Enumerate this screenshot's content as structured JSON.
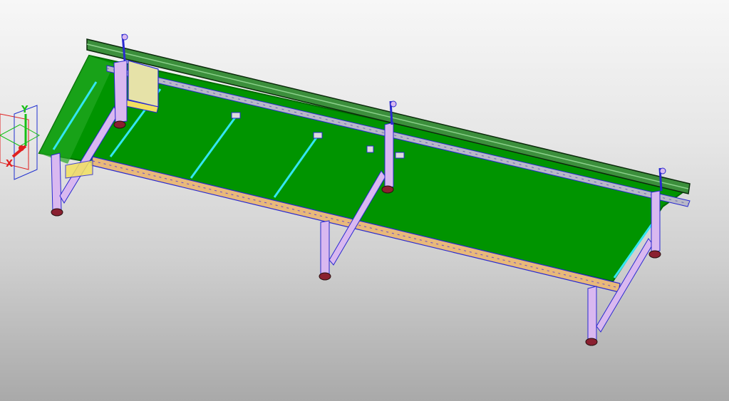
{
  "viewport": {
    "background_top": "#f7f7f7",
    "background_bottom": "#a9a9a9"
  },
  "model": {
    "belt_color": "#009400",
    "belt_edge_color": "#006b00",
    "rail_color": "#3c8f3c",
    "frame_color": "#d9b8f0",
    "frame_outline": "#2a2ad0",
    "crossbar_color": "#e8b97a",
    "highlight_color": "#33e6f2",
    "foot_color": "#8a2030",
    "motor_box_color": "#e6e2a8"
  },
  "triad": {
    "x_label": "X",
    "y_label": "Y",
    "x_color": "#e02020",
    "y_color": "#18c018",
    "z_color": "#2030d0"
  }
}
